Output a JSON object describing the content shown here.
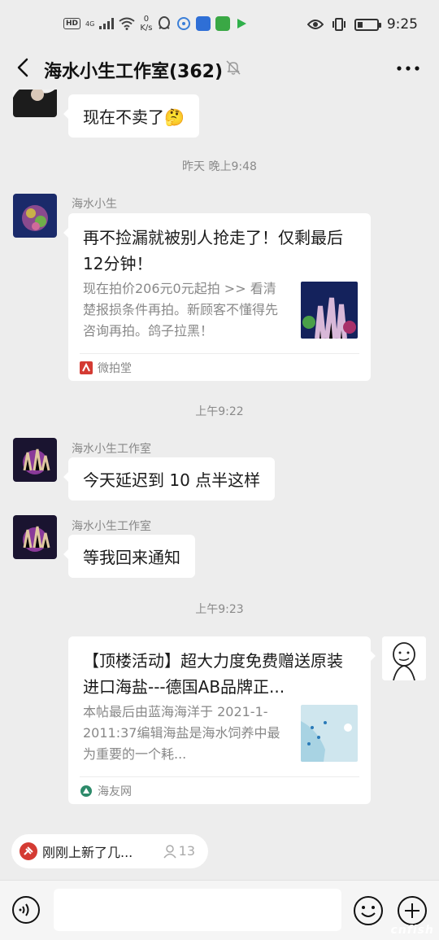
{
  "status_bar": {
    "hd": "HD",
    "network": "4G",
    "speed_value": "0",
    "speed_unit": "K/s",
    "time": "9:25",
    "battery_level": 0.25
  },
  "header": {
    "title": "海水小生工作室(362)",
    "back_icon": "back-chevron-icon",
    "mute_icon": "mute-bell-icon",
    "more_icon": "more-dots-icon"
  },
  "messages": {
    "m0_text": "现在不卖了🤔",
    "time1": "昨天 晚上9:48",
    "m1_sender": "海水小生",
    "m1_title": "再不捡漏就被别人抢走了！仅剩最后12分钟！",
    "m1_desc": "现在拍价206元0元起拍 >> 看清楚报损条件再拍。新顾客不懂得先咨询再拍。鸽子拉黑！",
    "m1_source": "微拍堂",
    "time2": "上午9:22",
    "m2_sender": "海水小生工作室",
    "m2_text": "今天延迟到 10 点半这样",
    "m3_sender": "海水小生工作室",
    "m3_text": "等我回来通知",
    "time3": "上午9:23",
    "m4_title": "【顶楼活动】超大力度免费赠送原装进口海盐---德国AB品牌正...",
    "m4_desc": "本帖最后由蓝海海洋于 2021-1-2011:37编辑海盐是海水饲养中最为重要的一个耗...",
    "m4_source": "海友网"
  },
  "pinned": {
    "text": "刚刚上新了几...",
    "count": "13"
  },
  "input_bar": {
    "voice_icon": "voice-icon",
    "emoji_icon": "emoji-icon",
    "plus_icon": "plus-icon"
  },
  "watermark": "cnfish"
}
